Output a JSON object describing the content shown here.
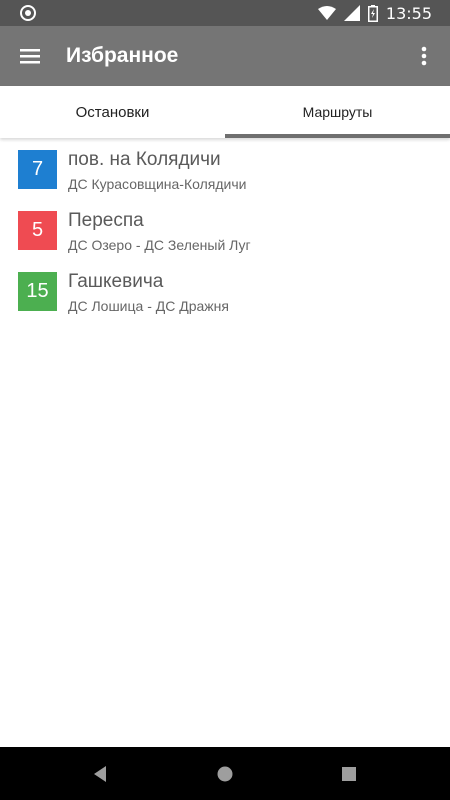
{
  "status_bar": {
    "time": "13:55"
  },
  "app_bar": {
    "title": "Избранное"
  },
  "tabs": [
    {
      "label": "Остановки",
      "selected": false
    },
    {
      "label": "Маршруты",
      "selected": true
    }
  ],
  "routes": [
    {
      "number": "7",
      "color": "#1e7fd1",
      "title": "пов. на Колядичи",
      "subtitle": "ДС Курасовщина-Колядичи"
    },
    {
      "number": "5",
      "color": "#ef4b52",
      "title": "Переспа",
      "subtitle": "ДС Озеро - ДС Зеленый Луг"
    },
    {
      "number": "15",
      "color": "#4caf50",
      "title": "Гашкевича",
      "subtitle": "ДС Лошица - ДС Дражня"
    }
  ],
  "colors": {
    "status_bar": "#555555",
    "app_bar": "#757575",
    "tab_indicator": "#6f6f6f",
    "nav_bar": "#000000"
  },
  "icons": {
    "status_left": "circle-notification-icon",
    "wifi": "wifi-icon",
    "signal": "signal-icon",
    "battery": "battery-charging-icon",
    "menu": "menu-icon",
    "more": "more-vert-icon",
    "back": "back-icon",
    "home": "home-icon",
    "recents": "recents-icon"
  }
}
